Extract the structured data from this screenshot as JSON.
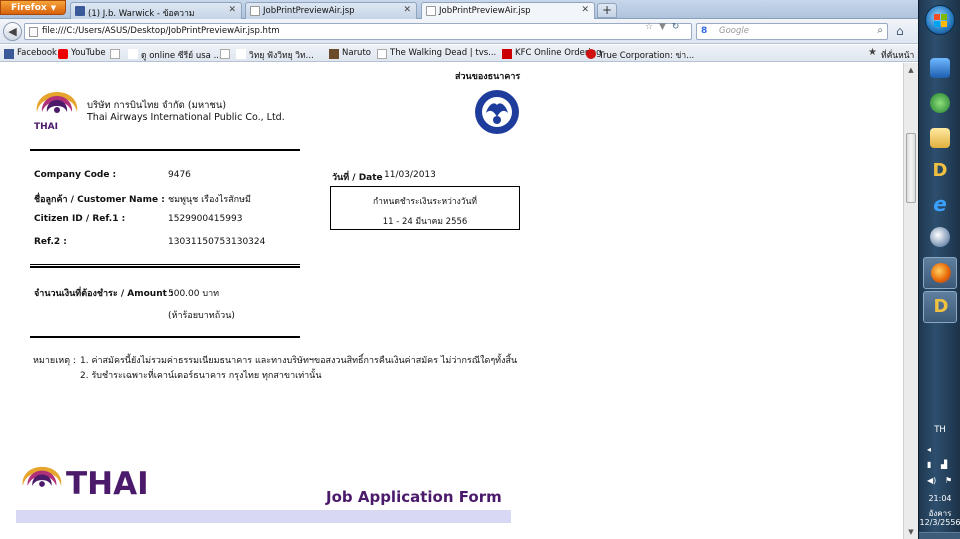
{
  "browser": {
    "app_button": "Firefox",
    "tabs": [
      {
        "label": "(1) J.b. Warwick - ข้อความ",
        "active": false
      },
      {
        "label": "JobPrintPreviewAir.jsp",
        "active": false
      },
      {
        "label": "JobPrintPreviewAir.jsp",
        "active": true
      }
    ],
    "url": "file:///C:/Users/ASUS/Desktop/JobPrintPreviewAir.jsp.htm",
    "search_placeholder": "Google",
    "bookmarks": [
      {
        "label": "Facebook",
        "icon": "facebook-icon"
      },
      {
        "label": "YouTube",
        "icon": "youtube-icon"
      },
      {
        "label": "",
        "icon": "page-icon"
      },
      {
        "label": "ดู online ซีรีย์ usa ...",
        "icon": "page-icon"
      },
      {
        "label": "",
        "icon": "page-icon"
      },
      {
        "label": "วิทยุ ฟังวิทยุ วิท...",
        "icon": "page-icon"
      },
      {
        "label": "Naruto",
        "icon": "naruto-icon"
      },
      {
        "label": "The Walking Dead | tvs...",
        "icon": "page-icon"
      },
      {
        "label": "KFC Online Ordering",
        "icon": "kfc-icon"
      },
      {
        "label": "True Corporation: ข่า...",
        "icon": "true-icon"
      },
      {
        "label": "ที่คั่นหน้า",
        "icon": "bookmarks-star-icon"
      }
    ]
  },
  "document": {
    "bank_section": "ส่วนของธนาคาร",
    "company_name_th": "บริษัท การบินไทย จำกัด (มหาชน)",
    "company_name_en": "Thai Airways International Public Co., Ltd.",
    "logo_caption": "THAI",
    "fields": [
      {
        "label": "Company Code :",
        "value": "9476"
      },
      {
        "label": "ชื่อลูกค้า / Customer Name :",
        "value": "ชมพูนุช เรืองไรสักษมี"
      },
      {
        "label": "Citizen ID / Ref.1 :",
        "value": "1529900415993"
      },
      {
        "label": "Ref.2 :",
        "value": "13031150753130324"
      }
    ],
    "date_label": "วันที่ / Date",
    "date_value": "11/03/2013",
    "due_title": "กำหนดชำระเงินระหว่างวันที่",
    "due_range": "11 - 24 มีนาคม 2556",
    "amount_label": "จำนวนเงินที่ต้องชำระ / Amount :",
    "amount_value": "500.00 บาท",
    "amount_words": "(ห้าร้อยบาทถ้วน)",
    "notes_label": "หมายเหตุ :",
    "notes": [
      "1. ค่าสมัครนี้ยังไม่รวมค่าธรรมเนียมธนาคาร และทางบริษัทฯขอสงวนสิทธิ์การคืนเงินค่าสมัคร ไม่ว่ากรณีใดๆทั้งสิ้น",
      "2. รับชำระเฉพาะที่เคาน์เตอร์ธนาคาร กรุงไทย ทุกสาขาเท่านั้น"
    ],
    "footer_brand": "THAI",
    "footer_title": "Job Application Form"
  },
  "taskbar": {
    "language": "TH",
    "time": "21:04",
    "day": "อังคาร",
    "date": "12/3/2556"
  },
  "colors": {
    "thai_purple": "#4b1a6b",
    "thai_gold": "#e6a52c",
    "thai_magenta": "#b0307a",
    "bank_blue": "#1e3c9c",
    "footer_band": "#d8d8f5"
  }
}
